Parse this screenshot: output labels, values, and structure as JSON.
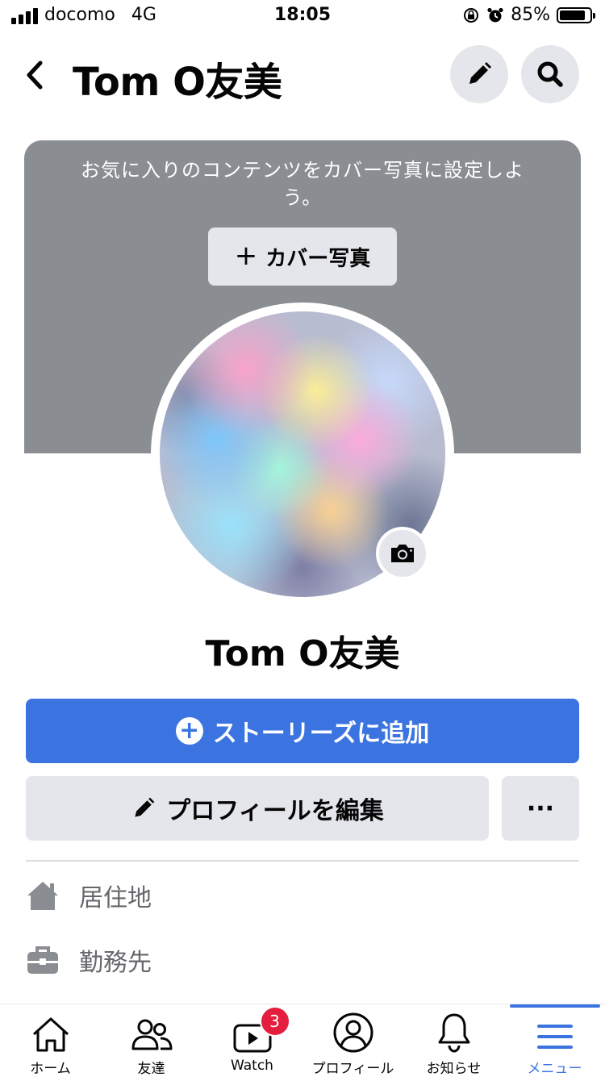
{
  "status_bar": {
    "carrier": "docomo",
    "network": "4G",
    "time": "18:05",
    "battery": "85%",
    "battery_level": 0.85,
    "icons": [
      "signal-icon",
      "orientation-lock-icon",
      "alarm-icon",
      "battery-icon"
    ]
  },
  "header": {
    "title": "Tom O友美",
    "back_icon": "chevron-left-icon",
    "edit_icon": "pencil-icon",
    "search_icon": "search-icon"
  },
  "cover": {
    "prompt": "お気に入りのコンテンツをカバー写真に設定しよう。",
    "button_label": "カバー写真",
    "button_icon": "plus-icon"
  },
  "profile": {
    "name": "Tom O友美",
    "camera_icon": "camera-icon"
  },
  "actions": {
    "story_button": "ストーリーズに追加",
    "edit_profile_button": "プロフィールを編集",
    "more_button": "···"
  },
  "details": [
    {
      "label": "居住地",
      "icon": "home-icon"
    },
    {
      "label": "勤務先",
      "icon": "briefcase-icon"
    }
  ],
  "tabs": [
    {
      "label": "ホーム",
      "icon": "home-icon"
    },
    {
      "label": "友達",
      "icon": "friends-icon"
    },
    {
      "label": "Watch",
      "icon": "watch-video-icon",
      "badge": "3"
    },
    {
      "label": "プロフィール",
      "icon": "profile-icon"
    },
    {
      "label": "お知らせ",
      "icon": "bell-icon"
    },
    {
      "label": "メニュー",
      "icon": "menu-icon",
      "active": true
    }
  ],
  "colors": {
    "accent": "#3b74e0",
    "cover_gray": "#8a8d91",
    "button_gray": "#e4e6eb",
    "badge_red": "#e41e3f",
    "secondary_text": "#65676b"
  }
}
